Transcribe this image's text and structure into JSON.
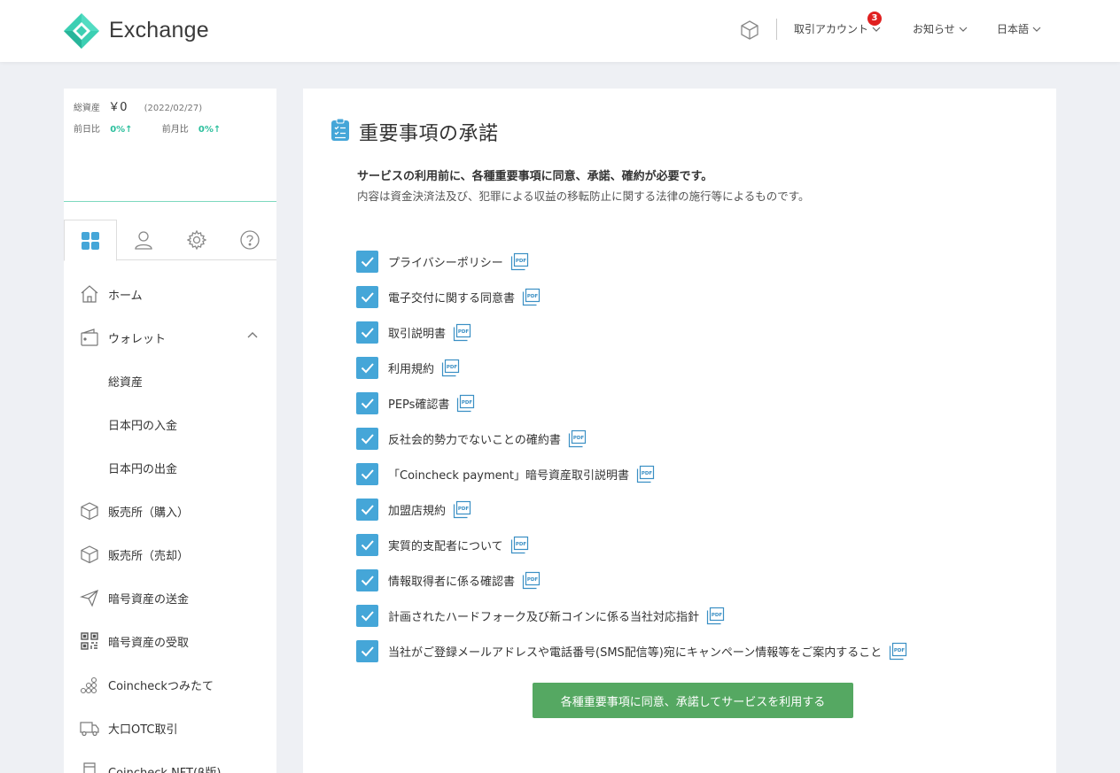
{
  "header": {
    "brand": "Exchange",
    "menu": {
      "account_label": "取引アカウント",
      "account_badge": "3",
      "news_label": "お知らせ",
      "language_label": "日本語"
    }
  },
  "sidebar": {
    "assets": {
      "total_label": "総資産",
      "total_value": "￥0",
      "date": "(2022/02/27)",
      "day_label": "前日比",
      "day_pct": "0%↑",
      "month_label": "前月比",
      "month_pct": "0%↑"
    },
    "tabs": [
      {
        "name": "dashboard-icon",
        "active": true
      },
      {
        "name": "user-icon",
        "active": false
      },
      {
        "name": "gear-icon",
        "active": false
      },
      {
        "name": "help-icon",
        "active": false
      }
    ],
    "nav": [
      {
        "label": "ホーム",
        "icon": "home-icon"
      },
      {
        "label": "ウォレット",
        "icon": "wallet-icon",
        "expanded": true
      },
      {
        "label": "総資産",
        "sub": true
      },
      {
        "label": "日本円の入金",
        "sub": true
      },
      {
        "label": "日本円の出金",
        "sub": true
      },
      {
        "label": "販売所（購入）",
        "icon": "box-icon"
      },
      {
        "label": "販売所（売却）",
        "icon": "box-icon"
      },
      {
        "label": "暗号資産の送金",
        "icon": "send-icon"
      },
      {
        "label": "暗号資産の受取",
        "icon": "qr-icon"
      },
      {
        "label": "Coincheckつみたて",
        "icon": "coins-icon"
      },
      {
        "label": "大口OTC取引",
        "icon": "truck-icon"
      },
      {
        "label": "Coincheck NFT(β版)",
        "icon": "nft-icon"
      }
    ]
  },
  "main": {
    "title": "重要事項の承諾",
    "lead_bold": "サービスの利用前に、各種重要事項に同意、承諾、確約が必要です。",
    "lead": "内容は資金決済法及び、犯罪による収益の移転防止に関する法律の施行等によるものです。",
    "items": [
      {
        "label": "プライバシーポリシー",
        "checked": true
      },
      {
        "label": "電子交付に関する同意書",
        "checked": true
      },
      {
        "label": "取引説明書",
        "checked": true
      },
      {
        "label": "利用規約",
        "checked": true
      },
      {
        "label": "PEPs確認書",
        "checked": true
      },
      {
        "label": "反社会的勢力でないことの確約書",
        "checked": true
      },
      {
        "label": "「Coincheck payment」暗号資産取引説明書",
        "checked": true
      },
      {
        "label": "加盟店規約",
        "checked": true
      },
      {
        "label": "実質的支配者について",
        "checked": true
      },
      {
        "label": "情報取得者に係る確認書",
        "checked": true
      },
      {
        "label": "計画されたハードフォーク及び新コインに係る当社対応指針",
        "checked": true
      },
      {
        "label": "当社がご登録メールアドレスや電話番号(SMS配信等)宛にキャンペーン情報等をご案内すること",
        "checked": true
      }
    ],
    "submit_label": "各種重要事項に同意、承諾してサービスを利用する"
  },
  "colors": {
    "accent_blue": "#45a6d8",
    "brand_teal": "#2cbf9d",
    "submit_green": "#55a862",
    "badge_red": "#e02020"
  }
}
